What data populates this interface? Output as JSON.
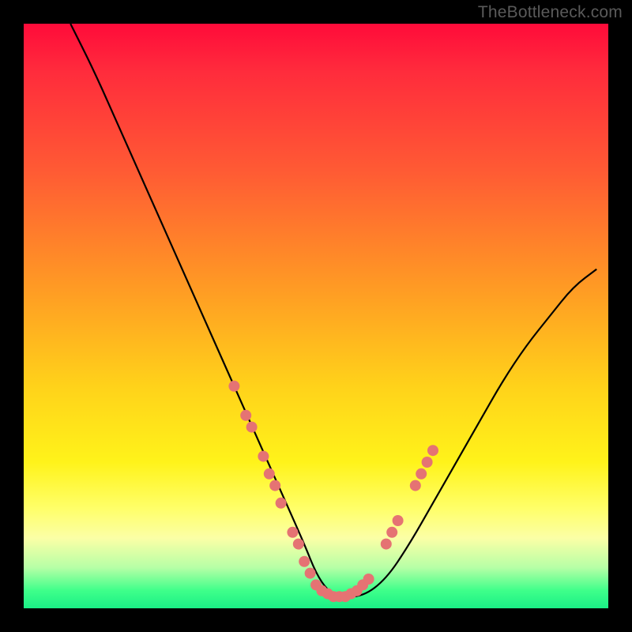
{
  "watermark": "TheBottleneck.com",
  "chart_data": {
    "type": "line",
    "title": "",
    "xlabel": "",
    "ylabel": "",
    "xlim": [
      0,
      100
    ],
    "ylim": [
      0,
      100
    ],
    "grid": false,
    "legend": false,
    "curve": {
      "name": "bottleneck-curve",
      "color": "#000000",
      "x": [
        8,
        12,
        16,
        20,
        24,
        28,
        32,
        36,
        40,
        44,
        48,
        50,
        52,
        54,
        58,
        62,
        66,
        70,
        74,
        78,
        82,
        86,
        90,
        94,
        98
      ],
      "y": [
        100,
        92,
        83,
        74,
        65,
        56,
        47,
        38,
        29,
        20,
        11,
        6,
        3,
        2,
        2,
        5,
        11,
        18,
        25,
        32,
        39,
        45,
        50,
        55,
        58
      ]
    },
    "markers": {
      "name": "highlight-dots",
      "color": "#e57373",
      "radius": 7,
      "points": [
        {
          "x": 36,
          "y": 38
        },
        {
          "x": 38,
          "y": 33
        },
        {
          "x": 39,
          "y": 31
        },
        {
          "x": 41,
          "y": 26
        },
        {
          "x": 42,
          "y": 23
        },
        {
          "x": 43,
          "y": 21
        },
        {
          "x": 44,
          "y": 18
        },
        {
          "x": 46,
          "y": 13
        },
        {
          "x": 47,
          "y": 11
        },
        {
          "x": 48,
          "y": 8
        },
        {
          "x": 49,
          "y": 6
        },
        {
          "x": 50,
          "y": 4
        },
        {
          "x": 51,
          "y": 3
        },
        {
          "x": 52,
          "y": 2.5
        },
        {
          "x": 53,
          "y": 2
        },
        {
          "x": 54,
          "y": 2
        },
        {
          "x": 55,
          "y": 2
        },
        {
          "x": 56,
          "y": 2.5
        },
        {
          "x": 57,
          "y": 3
        },
        {
          "x": 58,
          "y": 4
        },
        {
          "x": 59,
          "y": 5
        },
        {
          "x": 62,
          "y": 11
        },
        {
          "x": 63,
          "y": 13
        },
        {
          "x": 64,
          "y": 15
        },
        {
          "x": 67,
          "y": 21
        },
        {
          "x": 68,
          "y": 23
        },
        {
          "x": 69,
          "y": 25
        },
        {
          "x": 70,
          "y": 27
        }
      ]
    }
  }
}
